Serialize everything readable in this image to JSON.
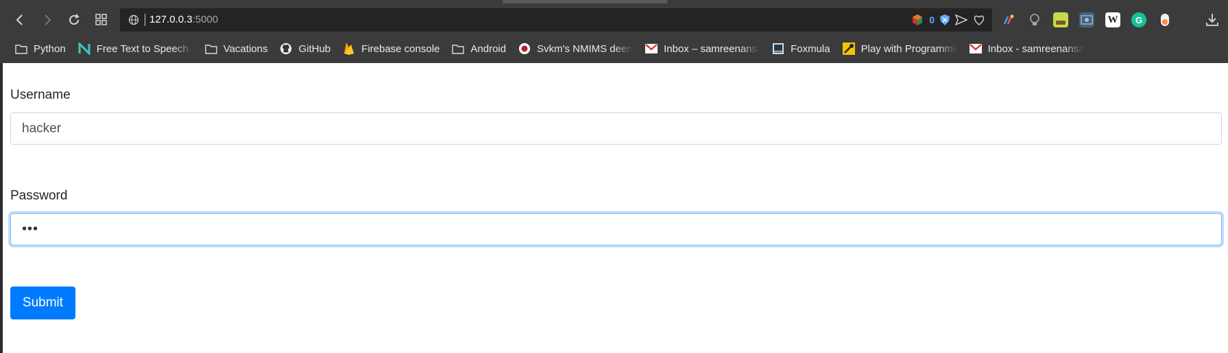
{
  "browser": {
    "address": {
      "host": "127.0.0.3",
      "port": ":5000",
      "blocked_count": "0"
    },
    "extensions": [
      {
        "name": "color-picker-icon",
        "color": "#e0a030"
      },
      {
        "name": "bulb-icon",
        "color": "#9a9a9a"
      },
      {
        "name": "yellow-extension-icon",
        "color": "#c8d84a"
      },
      {
        "name": "screenshot-icon",
        "color": "#6f8fb0"
      },
      {
        "name": "wikipedia-icon",
        "color": "#ffffff",
        "text": "W"
      },
      {
        "name": "grammarly-icon",
        "color": "#15c39a",
        "text": "G"
      },
      {
        "name": "toggle-icon",
        "color": "#ff8a3d"
      }
    ]
  },
  "bookmarks": [
    {
      "label": "Python",
      "icon": "folder-icon"
    },
    {
      "label": "Free Text to Speech C",
      "icon": "naturalreader-icon"
    },
    {
      "label": "Vacations",
      "icon": "folder-icon"
    },
    {
      "label": "GitHub",
      "icon": "github-icon"
    },
    {
      "label": "Firebase console",
      "icon": "firebase-icon"
    },
    {
      "label": "Android",
      "icon": "folder-icon"
    },
    {
      "label": "Svkm's NMIMS deem",
      "icon": "nmims-icon"
    },
    {
      "label": "Inbox – samreenansa",
      "icon": "gmail-icon"
    },
    {
      "label": "Foxmula",
      "icon": "foxmula-icon"
    },
    {
      "label": "Play with Programmin",
      "icon": "programming-icon"
    },
    {
      "label": "Inbox - samreenansar",
      "icon": "gmail-icon"
    }
  ],
  "form": {
    "username_label": "Username",
    "username_value": "hacker",
    "password_label": "Password",
    "password_value": "•••",
    "submit_label": "Submit"
  },
  "colors": {
    "primary": "#007bff",
    "chrome": "#3b3b3b",
    "focus": "#80bdff"
  }
}
